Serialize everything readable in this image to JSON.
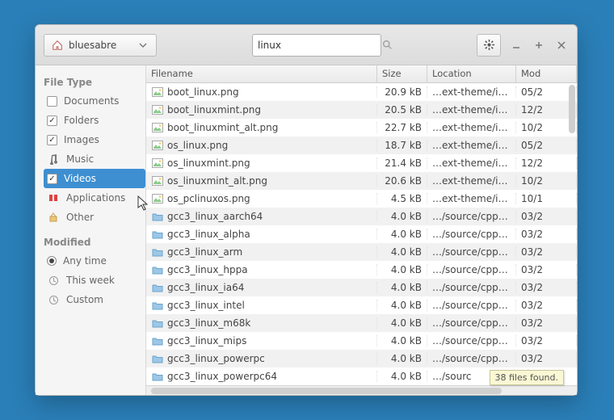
{
  "toolbar": {
    "path_label": "bluesabre",
    "search_value": "linux"
  },
  "sidebar": {
    "filetype_heading": "File Type",
    "items": [
      {
        "label": "Documents",
        "kind": "check",
        "checked": false
      },
      {
        "label": "Folders",
        "kind": "check",
        "checked": true
      },
      {
        "label": "Images",
        "kind": "check",
        "checked": true
      },
      {
        "label": "Music",
        "kind": "plain"
      },
      {
        "label": "Videos",
        "kind": "check",
        "checked": true,
        "selected": true
      },
      {
        "label": "Applications",
        "kind": "plain"
      },
      {
        "label": "Other",
        "kind": "plain"
      }
    ],
    "modified_heading": "Modified",
    "modified": [
      {
        "label": "Any time",
        "checked": true
      },
      {
        "label": "This week",
        "checked": false
      },
      {
        "label": "Custom",
        "checked": false
      }
    ]
  },
  "columns": {
    "name": "Filename",
    "size": "Size",
    "loc": "Location",
    "mod": "Mod"
  },
  "rows": [
    {
      "icon": "img",
      "name": "boot_linux.png",
      "size": "20.9 kB",
      "loc": "…ext-theme/icons",
      "mod": "05/2"
    },
    {
      "icon": "img",
      "name": "boot_linuxmint.png",
      "size": "20.5 kB",
      "loc": "…ext-theme/icons",
      "mod": "12/2"
    },
    {
      "icon": "img",
      "name": "boot_linuxmint_alt.png",
      "size": "22.7 kB",
      "loc": "…ext-theme/icons",
      "mod": "10/2"
    },
    {
      "icon": "img",
      "name": "os_linux.png",
      "size": "18.7 kB",
      "loc": "…ext-theme/icons",
      "mod": "05/2"
    },
    {
      "icon": "img",
      "name": "os_linuxmint.png",
      "size": "21.4 kB",
      "loc": "…ext-theme/icons",
      "mod": "12/2"
    },
    {
      "icon": "img",
      "name": "os_linuxmint_alt.png",
      "size": "20.6 kB",
      "loc": "…ext-theme/icons",
      "mod": "10/2"
    },
    {
      "icon": "img",
      "name": "os_pclinuxos.png",
      "size": "4.5 kB",
      "loc": "…ext-theme/icons",
      "mod": "10/1"
    },
    {
      "icon": "dir",
      "name": "gcc3_linux_aarch64",
      "size": "4.0 kB",
      "loc": "…/source/cpp_uno",
      "mod": "03/2"
    },
    {
      "icon": "dir",
      "name": "gcc3_linux_alpha",
      "size": "4.0 kB",
      "loc": "…/source/cpp_uno",
      "mod": "03/2"
    },
    {
      "icon": "dir",
      "name": "gcc3_linux_arm",
      "size": "4.0 kB",
      "loc": "…/source/cpp_uno",
      "mod": "03/2"
    },
    {
      "icon": "dir",
      "name": "gcc3_linux_hppa",
      "size": "4.0 kB",
      "loc": "…/source/cpp_uno",
      "mod": "03/2"
    },
    {
      "icon": "dir",
      "name": "gcc3_linux_ia64",
      "size": "4.0 kB",
      "loc": "…/source/cpp_uno",
      "mod": "03/2"
    },
    {
      "icon": "dir",
      "name": "gcc3_linux_intel",
      "size": "4.0 kB",
      "loc": "…/source/cpp_uno",
      "mod": "03/2"
    },
    {
      "icon": "dir",
      "name": "gcc3_linux_m68k",
      "size": "4.0 kB",
      "loc": "…/source/cpp_uno",
      "mod": "03/2"
    },
    {
      "icon": "dir",
      "name": "gcc3_linux_mips",
      "size": "4.0 kB",
      "loc": "…/source/cpp_uno",
      "mod": "03/2"
    },
    {
      "icon": "dir",
      "name": "gcc3_linux_powerpc",
      "size": "4.0 kB",
      "loc": "…/source/cpp_uno",
      "mod": "03/2"
    },
    {
      "icon": "dir",
      "name": "gcc3_linux_powerpc64",
      "size": "4.0 kB",
      "loc": "…/sourc",
      "mod": ""
    }
  ],
  "status": {
    "tooltip": "38 files found."
  }
}
